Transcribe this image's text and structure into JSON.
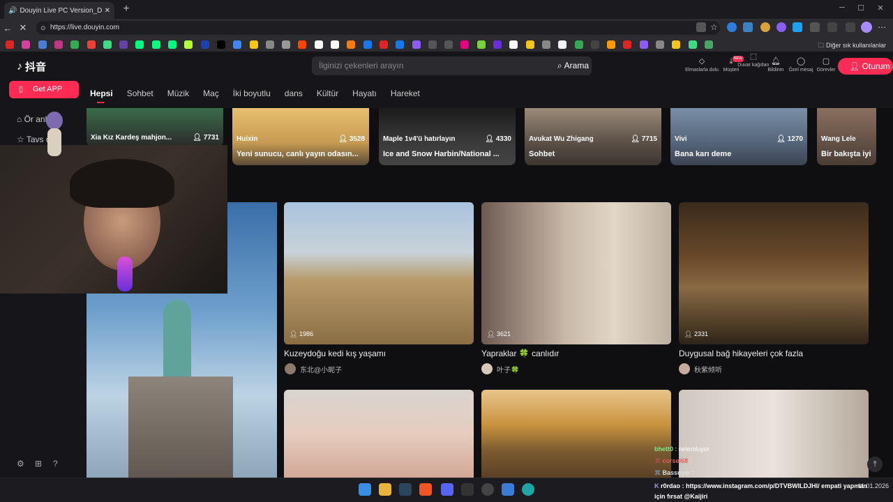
{
  "browser": {
    "tab_title": "Douyin Live PC Version_Douy",
    "url": "https://live.douyin.com",
    "other_bookmarks": "Diğer sık kullanılanlar"
  },
  "header": {
    "logo_text": "抖音",
    "search_placeholder": "İlginizi çekenleri arayın",
    "search_button": "Arama",
    "icons": [
      {
        "label": "Elmaslarla dolu",
        "icon": "diamond-icon"
      },
      {
        "label": "Müşteri",
        "icon": "download-icon",
        "badge": "NEW"
      },
      {
        "label": "Duvar kağıtları",
        "icon": "wallpaper-icon"
      },
      {
        "label": "Bildirim",
        "icon": "bell-icon"
      },
      {
        "label": "Özel mesaj",
        "icon": "message-icon"
      },
      {
        "label": "Görevler",
        "icon": "task-icon"
      }
    ],
    "login_label": "Oturum aç"
  },
  "get_app_label": "Get APP",
  "categories": [
    "Hepsi",
    "Sohbet",
    "Müzik",
    "Maç",
    "İki boyutlu",
    "dans",
    "Kültür",
    "Hayatı",
    "Hareket"
  ],
  "sidebar": {
    "items": [
      "Ör anla",
      "Tavs diili"
    ]
  },
  "top_cards": [
    {
      "author": "Xia Kız Kardeş mahjon...",
      "viewers": "7731",
      "title": ""
    },
    {
      "author": "Huixin",
      "viewers": "3528",
      "title": "Yeni sunucu, canlı yayın odasın..."
    },
    {
      "author": "Maple 1v4'ü hatırlayın",
      "viewers": "4330",
      "title": "Ice and Snow Harbin/National ..."
    },
    {
      "author": "Avukat Wu Zhigang",
      "viewers": "7715",
      "title": "Sohbet"
    },
    {
      "author": "Vivi",
      "viewers": "1270",
      "title": "Bana karı deme"
    },
    {
      "author": "Wang Lele",
      "viewers": "",
      "title": "Bir bakışta iyi d"
    }
  ],
  "cards": [
    {
      "viewers": "1986",
      "title": "Kuzeydoğu kedi kış yaşamı",
      "author": "东北@小昵子"
    },
    {
      "viewers": "3621",
      "title": "Yapraklar 🍀 canlıdır",
      "author": "叶子🍀"
    },
    {
      "viewers": "2331",
      "title": "Duygusal bağ hikayeleri çok fazla",
      "author": "秋紫倾听"
    }
  ],
  "chat": [
    {
      "user": "bhett0",
      "text": "neleroluyor"
    },
    {
      "user": "corsel68",
      "text": ""
    },
    {
      "user": "Bassuyoi",
      "text": ""
    }
  ],
  "chat_main": "r0rdao : https://www.instagram.com/p/DTVBWILDJHI/ empati yapman",
  "chat_main2": "için fırsat @Kaijiri",
  "clock": {
    "time": "",
    "date": "11.01.2026"
  },
  "colors": {
    "accent": "#fe2c55",
    "bg": "#0f0f12"
  }
}
